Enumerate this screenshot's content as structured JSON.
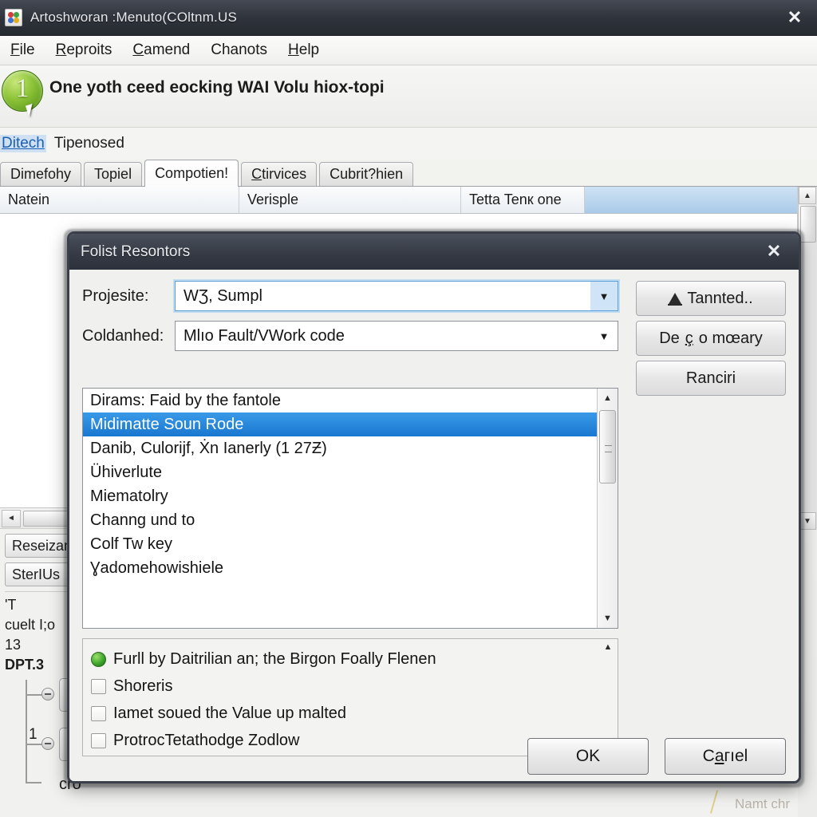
{
  "window": {
    "title": "Artoshworan :Menuto(COltnm.US",
    "close_label": "✕",
    "icon": "app-icon"
  },
  "menubar": {
    "items": [
      {
        "pre": "",
        "mnem": "F",
        "post": "ile"
      },
      {
        "pre": "",
        "mnem": "R",
        "post": "eproits"
      },
      {
        "pre": "",
        "mnem": "C",
        "post": "amend"
      },
      {
        "pre": "",
        "mnem": "",
        "post": "Chanots"
      },
      {
        "pre": "",
        "mnem": "H",
        "post": "elp"
      }
    ]
  },
  "banner": {
    "badge_number": "1",
    "text": "One yoth ceed eocking WAI Volu hiox-topi"
  },
  "breadcrumb": {
    "link": "Ditech",
    "text": "Tipenosed"
  },
  "tabs": [
    {
      "label": "Dimefohy",
      "active": false,
      "mnem": ""
    },
    {
      "label": "Topiel",
      "active": false,
      "mnem": ""
    },
    {
      "label": "Compotien!",
      "active": true,
      "mnem": ""
    },
    {
      "label": "tirvices",
      "active": false,
      "mnem": "C"
    },
    {
      "label": "Cubrit?hien",
      "active": false,
      "mnem": ""
    }
  ],
  "grid": {
    "columns": [
      "Natein",
      "Verisple",
      "Tetta Tenк one",
      ""
    ],
    "scroll_up": "▲",
    "scroll_down": "▼",
    "scroll_left": "◄"
  },
  "left_panel": {
    "buttons": [
      "Reseizan",
      "SterIUs"
    ],
    "lines": [
      "'T",
      "cuelt I;o",
      "13"
    ],
    "bold_line": "DPT.3",
    "tree": {
      "node1": "M",
      "node2": "M",
      "branch_number": "1",
      "leaf": "cro"
    },
    "corner_note": "Namt chr"
  },
  "dialog": {
    "title": "Folist Resontors",
    "close_label": "✕",
    "fields": [
      {
        "label": "Projesite:",
        "value": "WƷ, Sumpl",
        "focused": true
      },
      {
        "label": "Coldanhed:",
        "value": "Mlıo Fault/VWork code",
        "focused": false
      }
    ],
    "side_buttons": [
      {
        "label": "Tannted..",
        "icon": "warning-icon",
        "mnem": ""
      },
      {
        "label": "De",
        "mnem": "ç",
        "post": "o mœary",
        "icon": ""
      },
      {
        "label": "Ranciri",
        "icon": "",
        "mnem": ""
      }
    ],
    "list_items": [
      {
        "text": "Dirams: Faid by the fantole",
        "selected": false
      },
      {
        "text": "Midimatte Soun Rode",
        "selected": true
      },
      {
        "text": "Danib, Culorijf, Ẋn Ianerly (1 27Ƶ)",
        "selected": false
      },
      {
        "text": "Ühiverlute",
        "selected": false
      },
      {
        "text": "Miematolry",
        "selected": false
      },
      {
        "text": "Channg und to",
        "selected": false
      },
      {
        "text": "Colf Tw key",
        "selected": false
      },
      {
        "text": "Ɣadomehowishiele",
        "selected": false
      }
    ],
    "options": [
      {
        "text": "Furll by Daitrilian an; the Birgon Foally Flenen",
        "control": "radio",
        "checked": true
      },
      {
        "text": "Shoreris",
        "control": "checkbox",
        "checked": false
      },
      {
        "text": "Іamet soued the Value up malted",
        "control": "checkbox",
        "checked": false
      },
      {
        "text": "ProtrocTetathodge Zodlow",
        "control": "checkbox",
        "checked": false
      }
    ],
    "footer": {
      "ok": "OK",
      "cancel_pre": "C",
      "cancel_mnem": "a",
      "cancel_post": "гıel"
    },
    "scroll": {
      "up": "▲",
      "down": "▼"
    }
  },
  "colors": {
    "titlebar": "#343943",
    "selection": "#1877cf",
    "link": "#1a5fb4",
    "badge_green": "#4d8b14"
  }
}
